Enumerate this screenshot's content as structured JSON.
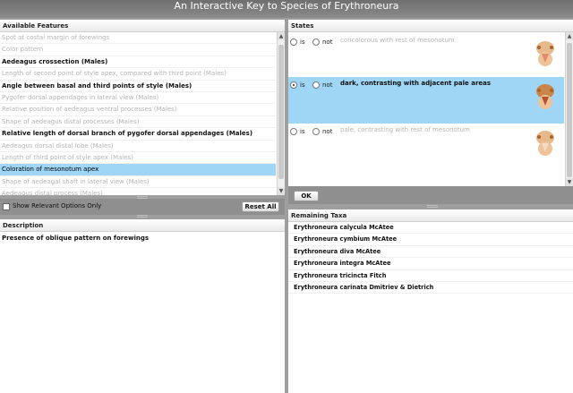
{
  "app": {
    "title": "An Interactive Key to Species of Erythroneura"
  },
  "features": {
    "header": "Available Features",
    "items": [
      {
        "label": "Spot at costal margin of forewings",
        "style": "dim"
      },
      {
        "label": "Color pattern",
        "style": "dim"
      },
      {
        "label": "Aedeagus crossection (Males)",
        "style": "bold"
      },
      {
        "label": "Length of second point of style apex, compared with third point (Males)",
        "style": "dim"
      },
      {
        "label": "Angle between basal and third points of style (Males)",
        "style": "bold"
      },
      {
        "label": "Pygofer dorsal appendages in lateral view (Males)",
        "style": "dim"
      },
      {
        "label": "Relative position of aedeagus ventral processes (Males)",
        "style": "dim"
      },
      {
        "label": "Shape of aedeagus distal processes (Males)",
        "style": "dim"
      },
      {
        "label": "Relative length of dorsal branch of pygofer dorsal appendages (Males)",
        "style": "bold"
      },
      {
        "label": "Aedeagus dorsal distal lobe (Males)",
        "style": "dim"
      },
      {
        "label": "Length of third point of style apex (Males)",
        "style": "dim"
      },
      {
        "label": "Coloration of mesonotum apex",
        "style": "sel"
      },
      {
        "label": "Shape of aedeagal shaft in lateral view (Males)",
        "style": "dim"
      },
      {
        "label": "Aedeagus distal process (Males)",
        "style": "dim"
      }
    ]
  },
  "options": {
    "show_relevant_label": "Show Relevant Options Only",
    "reset_label": "Reset All"
  },
  "description": {
    "header": "Description",
    "text": "Presence of oblique pattern on forewings"
  },
  "states": {
    "header": "States",
    "is_label": "is",
    "not_label": "not",
    "items": [
      {
        "label": "concolorous with rest of mesonotum",
        "style": "dim",
        "is_checked": false
      },
      {
        "label": "dark, contrasting with adjacent pale areas",
        "style": "bold",
        "is_checked": true
      },
      {
        "label": "pale, contrasting with rest of mesonotum",
        "style": "dim",
        "is_checked": false
      }
    ],
    "ok_label": "OK"
  },
  "taxa": {
    "header": "Remaining Taxa",
    "items": [
      "Erythroneura calycula McAtee",
      "Erythroneura cymbium McAtee",
      "Erythroneura diva McAtee",
      "Erythroneura integra McAtee",
      "Erythroneura tricincta Fitch",
      "Erythroneura carinata Dmitriev & Dietrich"
    ]
  },
  "colors": {
    "selection": "#9fd5f5",
    "titlebar": "#7a7a7a"
  }
}
